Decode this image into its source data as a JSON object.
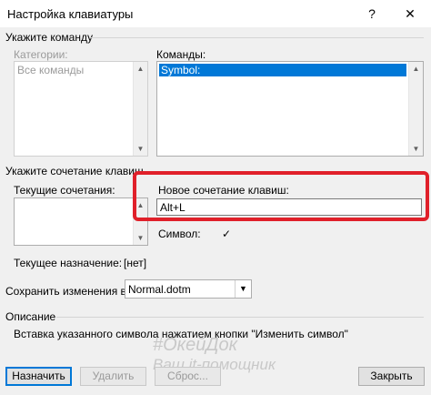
{
  "window": {
    "title": "Настройка клавиатуры",
    "help_glyph": "?",
    "close_glyph": "✕"
  },
  "command_group": {
    "title": "Укажите команду",
    "categories_label": "Категории:",
    "categories_items": [
      "Все команды"
    ],
    "commands_label": "Команды:",
    "commands_items": [
      "Symbol:"
    ]
  },
  "shortcut_group": {
    "title": "Укажите сочетание клавиш",
    "current_label": "Текущие сочетания:",
    "new_label": "Новое сочетание клавиш:",
    "new_value": "Alt+L",
    "symbol_label": "Символ:",
    "symbol_value": "✓"
  },
  "assignment": {
    "label": "Текущее назначение:",
    "value": "[нет]"
  },
  "save": {
    "label": "Сохранить изменения в:",
    "value": "Normal.dotm"
  },
  "description": {
    "title": "Описание",
    "text": "Вставка указанного символа нажатием кнопки \"Изменить символ\""
  },
  "buttons": {
    "assign": "Назначить",
    "remove": "Удалить",
    "reset": "Сброс...",
    "close": "Закрыть"
  },
  "watermark": {
    "line1": "#ОкейДок",
    "line2": "Ваш it-помощник"
  },
  "colors": {
    "selection": "#0078d7",
    "highlight": "#e0202a"
  }
}
